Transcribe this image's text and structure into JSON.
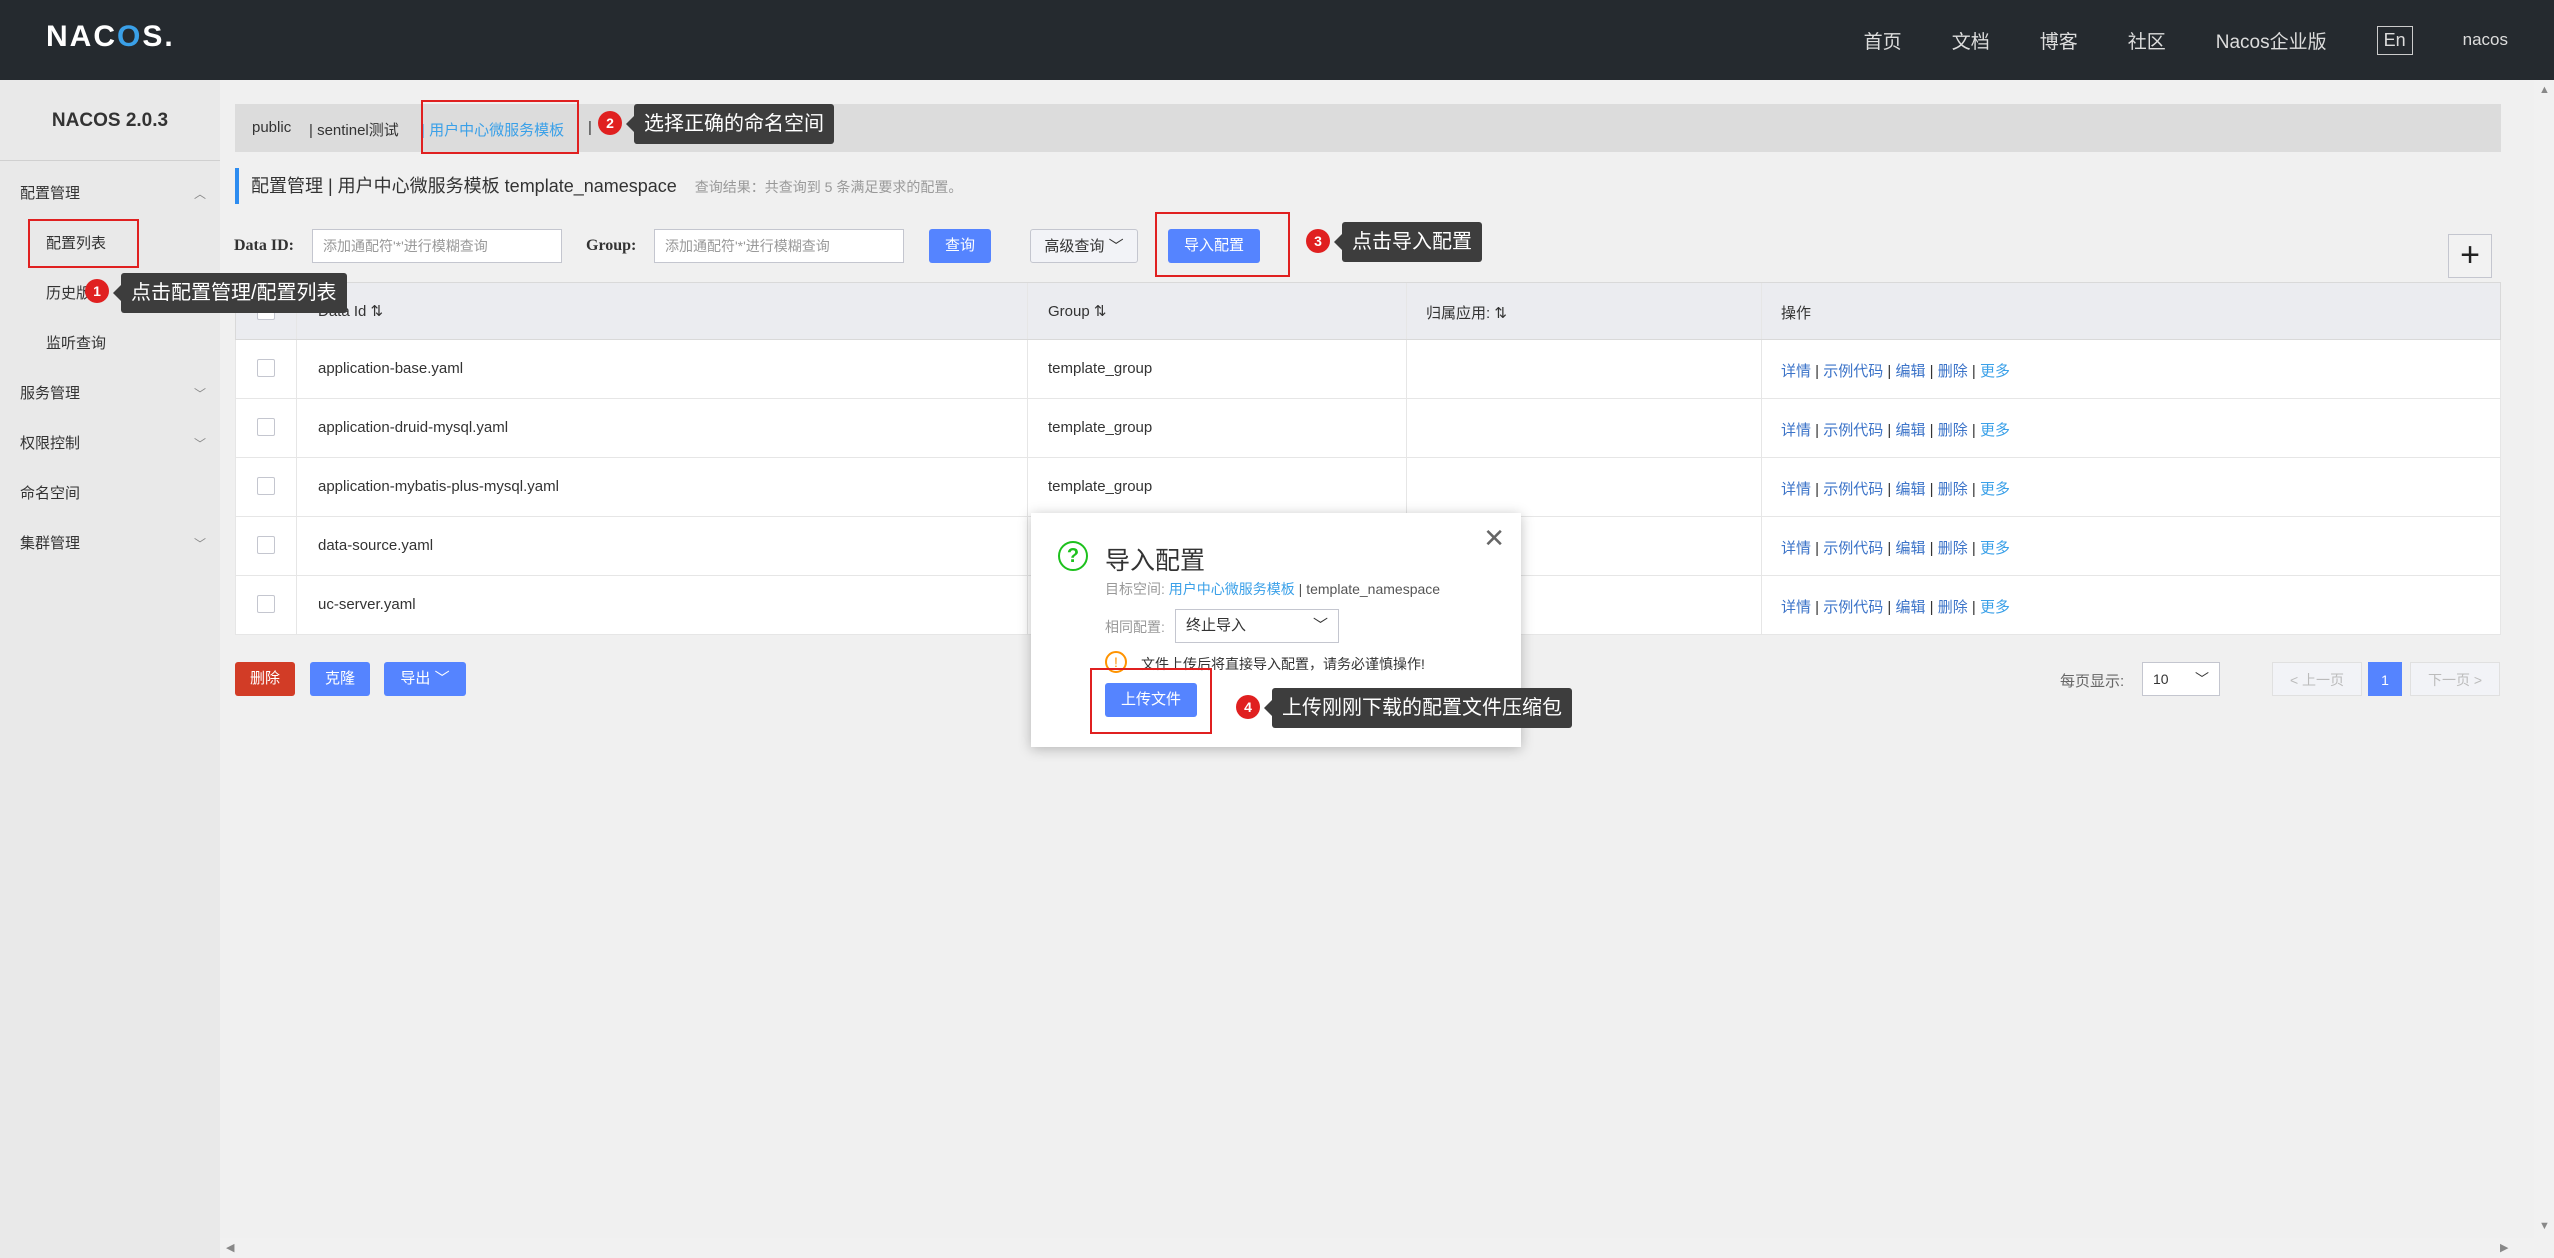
{
  "topbar": {
    "logo_pre": "NAC",
    "logo_o": "O",
    "logo_post": "S.",
    "nav": [
      "首页",
      "文档",
      "博客",
      "社区",
      "Nacos企业版"
    ],
    "lang": "En",
    "user": "nacos"
  },
  "sidebar": {
    "version": "NACOS 2.0.3",
    "items": [
      {
        "label": "配置管理",
        "chevron": "chevron-up"
      },
      {
        "label": "配置列表"
      },
      {
        "label": "历史版本"
      },
      {
        "label": "监听查询"
      },
      {
        "label": "服务管理",
        "chevron": "chevron-down"
      },
      {
        "label": "权限控制",
        "chevron": "chevron-down"
      },
      {
        "label": "命名空间"
      },
      {
        "label": "集群管理",
        "chevron": "chevron-down"
      }
    ]
  },
  "namespaces": [
    "public",
    "| sentinel测试",
    "| 用户中心微服务模板",
    "|"
  ],
  "breadcrumb": {
    "text": "配置管理 | 用户中心微服务模板 template_namespace",
    "hint": "查询结果：共查询到 5 条满足要求的配置。"
  },
  "search": {
    "dataid_label": "Data ID:",
    "dataid_placeholder": "添加通配符'*'进行模糊查询",
    "group_label": "Group:",
    "group_placeholder": "添加通配符'*'进行模糊查询",
    "query": "查询",
    "advanced": "高级查询",
    "import": "导入配置",
    "add": "+"
  },
  "table": {
    "headers": [
      "Data Id",
      "Group",
      "归属应用:",
      "操作"
    ],
    "rows": [
      {
        "dataid": "application-base.yaml",
        "group": "template_group"
      },
      {
        "dataid": "application-druid-mysql.yaml",
        "group": "template_group"
      },
      {
        "dataid": "application-mybatis-plus-mysql.yaml",
        "group": "template_group"
      },
      {
        "dataid": "data-source.yaml",
        "group": ""
      },
      {
        "dataid": "uc-server.yaml",
        "group": ""
      }
    ],
    "ops": [
      "详情",
      "示例代码",
      "编辑",
      "删除",
      "更多"
    ]
  },
  "footer": {
    "delete": "删除",
    "clone": "克隆",
    "export": "导出",
    "page_size_label": "每页显示:",
    "page_size": "10",
    "prev": "< 上一页",
    "page": "1",
    "next": "下一页 >"
  },
  "dialog": {
    "title": "导入配置",
    "target_label": "目标空间:",
    "target_ns": "用户中心微服务模板",
    "target_sep": " | ",
    "target_id": "template_namespace",
    "same_label": "相同配置:",
    "same_value": "终止导入",
    "warning": "文件上传后将直接导入配置，请务必谨慎操作!",
    "upload": "上传文件"
  },
  "annotations": [
    {
      "num": "1",
      "text": "点击配置管理/配置列表"
    },
    {
      "num": "2",
      "text": "选择正确的命名空间"
    },
    {
      "num": "3",
      "text": "点击导入配置"
    },
    {
      "num": "4",
      "text": "上传刚刚下载的配置文件压缩包"
    }
  ],
  "colors": {
    "topbar": "#252a2f",
    "primary": "#5584ff",
    "link": "#3aa0e8",
    "danger": "#d23c26",
    "annotation": "#e02020"
  }
}
